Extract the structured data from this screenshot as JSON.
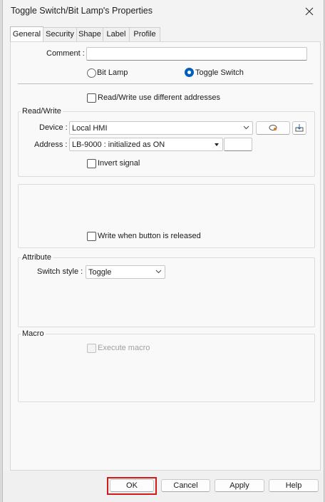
{
  "window": {
    "title": "Toggle Switch/Bit Lamp's Properties"
  },
  "tabs": [
    {
      "label": "General"
    },
    {
      "label": "Security"
    },
    {
      "label": "Shape"
    },
    {
      "label": "Label"
    },
    {
      "label": "Profile"
    }
  ],
  "general": {
    "comment_label": "Comment :",
    "comment_value": "",
    "type_options": [
      "Bit Lamp",
      "Toggle Switch"
    ],
    "type_selected": "Toggle Switch",
    "rw_different_label": "Read/Write use different addresses",
    "read_write": {
      "title": "Read/Write",
      "device_label": "Device :",
      "device_value": "Local HMI",
      "address_label": "Address :",
      "address_value": "LB-9000 : initialized as ON",
      "invert_label": "Invert signal"
    },
    "write_release_label": "Write when button is released",
    "attribute": {
      "title": "Attribute",
      "switch_style_label": "Switch style :",
      "switch_style_value": "Toggle"
    },
    "macro": {
      "title": "Macro",
      "execute_label": "Execute macro"
    }
  },
  "buttons": {
    "ok": "OK",
    "cancel": "Cancel",
    "apply": "Apply",
    "help": "Help"
  }
}
